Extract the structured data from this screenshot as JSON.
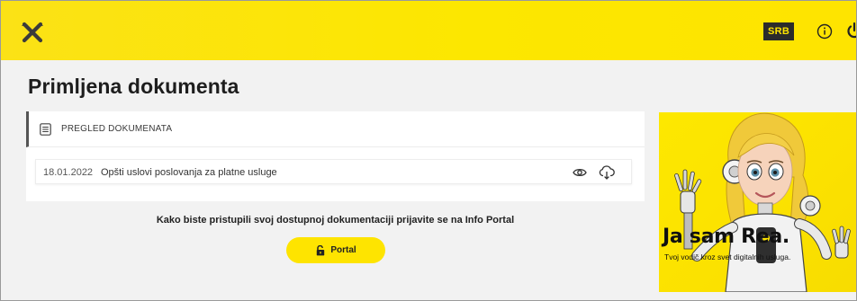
{
  "header": {
    "logo_icon": "raiffeisen-crossed-horses-logo",
    "language_label": "SRB",
    "info_icon": "info-circle-icon",
    "power_icon": "power-icon",
    "accent_color": "#fee400",
    "badge_bg": "#2b2b2b"
  },
  "page": {
    "title": "Primljena dokumenta"
  },
  "documents_panel": {
    "header_label": "PREGLED DOKUMENATA",
    "header_icon": "document-list-icon",
    "rows": [
      {
        "date": "18.01.2022",
        "title": "Opšti uslovi poslovanja za platne usluge",
        "actions": [
          "eye-icon",
          "cloud-download-icon"
        ]
      }
    ]
  },
  "portal": {
    "message": "Kako biste pristupili svoj dostupnoj dokumentaciji prijavite se na Info Portal",
    "button_label": "Portal",
    "button_icon": "unlock-icon"
  },
  "promo": {
    "title": "Ja sam Rea.",
    "subtitle": "Tvoj vodič kroz svet digitalnih usluga."
  }
}
